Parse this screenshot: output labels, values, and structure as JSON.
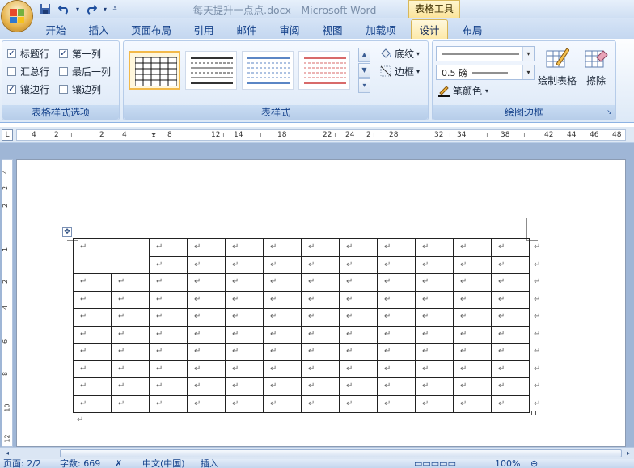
{
  "titlebar": {
    "document_title": "每天提升一点点.docx - Microsoft Word",
    "context_tab_group": "表格工具",
    "quick_access": [
      "save-icon",
      "undo-icon",
      "redo-icon"
    ]
  },
  "tabs": [
    {
      "label": "开始"
    },
    {
      "label": "插入"
    },
    {
      "label": "页面布局"
    },
    {
      "label": "引用"
    },
    {
      "label": "邮件"
    },
    {
      "label": "审阅"
    },
    {
      "label": "视图"
    },
    {
      "label": "加载项"
    },
    {
      "label": "设计",
      "active": true
    },
    {
      "label": "布局"
    }
  ],
  "ribbon": {
    "style_options": {
      "label": "表格样式选项",
      "items": [
        {
          "label": "标题行",
          "checked": true
        },
        {
          "label": "第一列",
          "checked": true
        },
        {
          "label": "汇总行",
          "checked": false
        },
        {
          "label": "最后一列",
          "checked": false
        },
        {
          "label": "镶边行",
          "checked": true
        },
        {
          "label": "镶边列",
          "checked": false
        }
      ]
    },
    "table_styles": {
      "label": "表样式",
      "shading_label": "底纹",
      "borders_label": "边框",
      "swatch_colors": [
        "#222222",
        "#555555",
        "#5b86c5",
        "#d86a6a"
      ]
    },
    "draw_borders": {
      "label": "绘图边框",
      "line_weight": "0.5 磅",
      "pen_color_label": "笔颜色",
      "draw_table_label": "绘制表格",
      "eraser_label": "擦除"
    }
  },
  "ruler": {
    "corner": "L",
    "numbers": [
      "4",
      "2",
      "2",
      "4",
      "8",
      "12",
      "14",
      "18",
      "22",
      "24",
      "2",
      "28",
      "32",
      "34",
      "38",
      "42",
      "44",
      "46",
      "48"
    ],
    "vertical_numbers": [
      "4",
      "2",
      "2",
      "1",
      "2",
      "4",
      "6",
      "8",
      "10",
      "12"
    ]
  },
  "document": {
    "para_mark": "↵",
    "rows": 10,
    "cols": 12
  },
  "statusbar": {
    "page": "页面: 2/2",
    "words": "字数: 669",
    "language": "中文(中国)",
    "insert_mode": "插入",
    "zoom": "100%"
  }
}
